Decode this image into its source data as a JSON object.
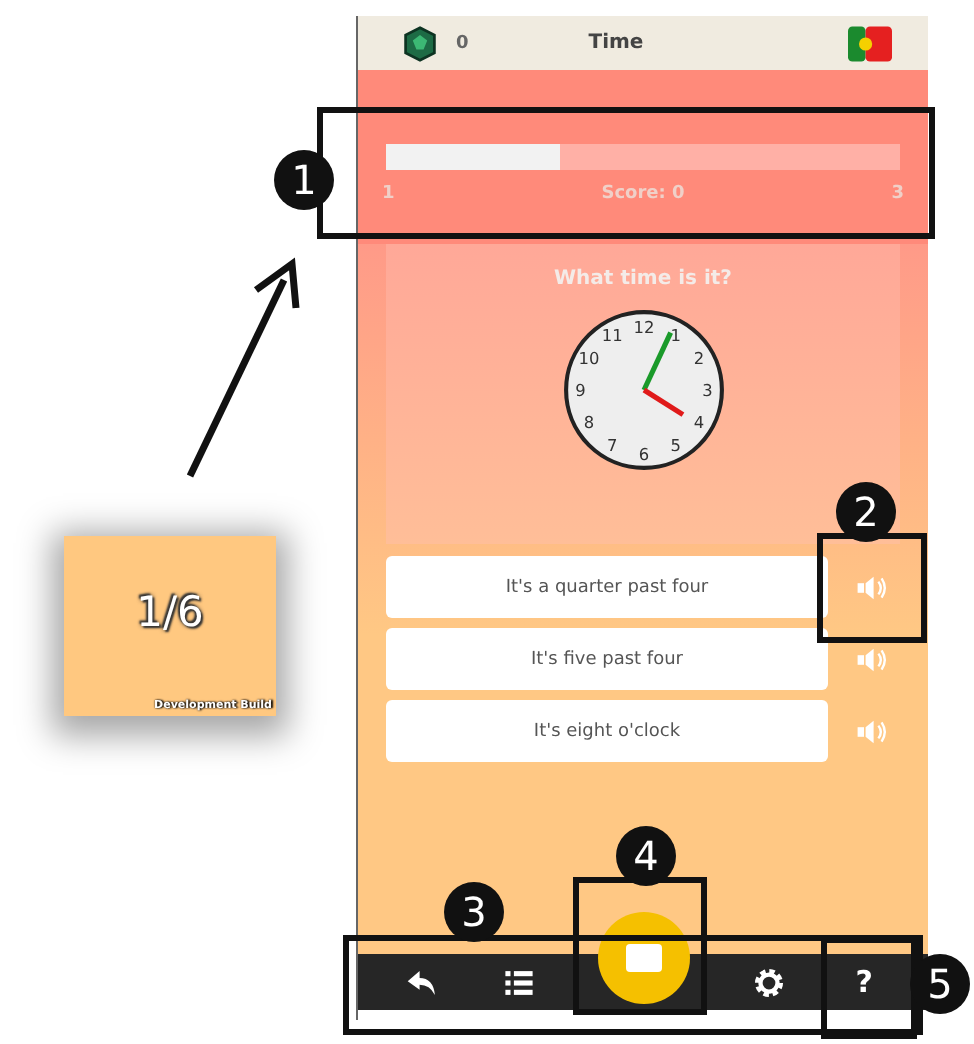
{
  "header": {
    "gems": "0",
    "title": "Time"
  },
  "progress": {
    "level": 0.34,
    "start": "1",
    "score": "Score: 0",
    "end": "3"
  },
  "question": "What time is it?",
  "clock": {
    "numerals": [
      "11",
      "12",
      "1",
      "10",
      "2",
      "9",
      "3",
      "8",
      "4",
      "7",
      "5",
      "6"
    ]
  },
  "answers": [
    {
      "text": "It's a quarter past four"
    },
    {
      "text": "It's five past four"
    },
    {
      "text": "It's eight o'clock"
    }
  ],
  "toolbar": [
    {
      "kind": "back"
    },
    {
      "kind": "list"
    },
    {
      "kind": "stop"
    },
    {
      "kind": "settings"
    },
    {
      "kind": "help",
      "label": "?"
    }
  ],
  "inset": {
    "counter": "1/6",
    "note": "Development Build"
  },
  "callouts": [
    "1",
    "2",
    "3",
    "4",
    "5"
  ]
}
